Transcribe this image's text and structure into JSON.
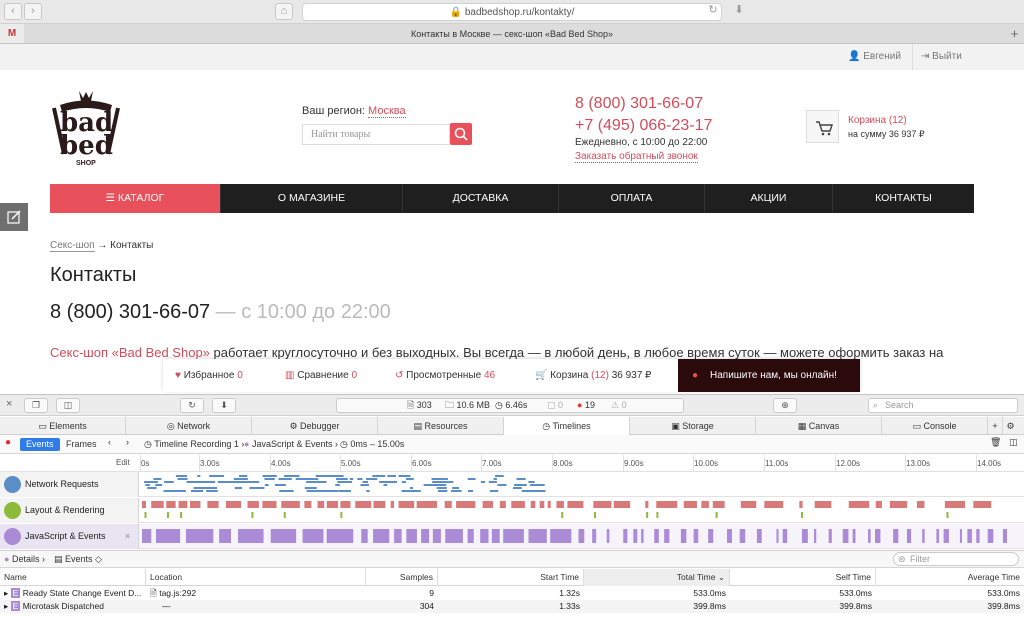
{
  "browser": {
    "url": "badbedshop.ru/kontakty/",
    "tab_title": "Контакты в Москве — секс-шоп «Bad Bed Shop»"
  },
  "site": {
    "user_name": "Евгений",
    "logout": "Выйти",
    "logo": {
      "line1": "bad",
      "line2": "bed",
      "line3": "SHOP"
    },
    "region_label": "Ваш регион:",
    "region_value": "Москва",
    "search_placeholder": "Найти товары",
    "phone1": "8 (800) 301-66-07",
    "phone2": "+7 (495) 066-23-17",
    "hours": "Ежедневно, с 10:00 до 22:00",
    "callback": "Заказать обратный звонок",
    "cart_title": "Корзина (12)",
    "cart_sum": "на сумму 36 937 ₽",
    "menu": [
      "КАТАЛОГ",
      "О МАГАЗИНЕ",
      "ДОСТАВКА",
      "ОПЛАТА",
      "АКЦИИ",
      "КОНТАКТЫ"
    ],
    "breadcrumb_link": "Секс-шоп",
    "breadcrumb_current": "→ Контакты",
    "page_title": "Контакты",
    "big_phone": "8 (800) 301-66-07",
    "big_hours": " — с 10:00 до 22:00",
    "para_link": "Секс-шоп «Bad Bed Shop»",
    "para_text": " работает круглосуточно и без выходных. Вы всегда — в любой день, в любое время суток — можете оформить заказ на"
  },
  "floatbar": {
    "fav_label": "Избранное",
    "fav_count": "0",
    "cmp_label": "Сравнение",
    "cmp_count": "0",
    "viewed_label": "Просмотренные",
    "viewed_count": "46",
    "cart_label": "Корзина",
    "cart_count": "(12)",
    "cart_sum": "36 937 ₽",
    "chat": "Напишите нам, мы онлайн!"
  },
  "devtools": {
    "stats": {
      "resources": "303",
      "size": "10.6 MB",
      "time": "6.46s",
      "warnings": "0",
      "errors": "19",
      "logs": "0"
    },
    "search_placeholder": "Search",
    "tabs": [
      "Elements",
      "Network",
      "Debugger",
      "Resources",
      "Timelines",
      "Storage",
      "Canvas",
      "Console"
    ],
    "active_tab": "Timelines",
    "timeline_bar": {
      "events": "Events",
      "frames": "Frames",
      "recording": "Timeline Recording 1",
      "scope": "JavaScript & Events",
      "range": "0ms – 15.00s"
    },
    "ruler_edit": "Edit",
    "ruler_ticks": [
      "0s",
      "3.00s",
      "4.00s",
      "5.00s",
      "6.00s",
      "7.00s",
      "8.00s",
      "9.00s",
      "10.00s",
      "11.00s",
      "12.00s",
      "13.00s",
      "14.00s"
    ],
    "rows": [
      "Network Requests",
      "Layout & Rendering",
      "JavaScript & Events"
    ],
    "details": {
      "label": "Details",
      "events": "Events",
      "filter_placeholder": "Filter"
    },
    "columns": [
      "Name",
      "Location",
      "Samples",
      "Start Time",
      "Total Time",
      "Self Time",
      "Average Time"
    ],
    "table": [
      {
        "name": "Ready State Change Event D...",
        "location": "tag.js:292",
        "samples": "9",
        "start": "1.32s",
        "total": "533.0ms",
        "self": "533.0ms",
        "avg": "533.0ms"
      },
      {
        "name": "Microtask Dispatched",
        "location": "—",
        "samples": "304",
        "start": "1.33s",
        "total": "399.8ms",
        "self": "399.8ms",
        "avg": "399.8ms"
      }
    ]
  },
  "colors": {
    "brand": "#e8505b",
    "dark_menu": "#1f1f1f",
    "network": "#5b8dc8",
    "layout": "#d97a7a",
    "js": "#a98bd6"
  }
}
